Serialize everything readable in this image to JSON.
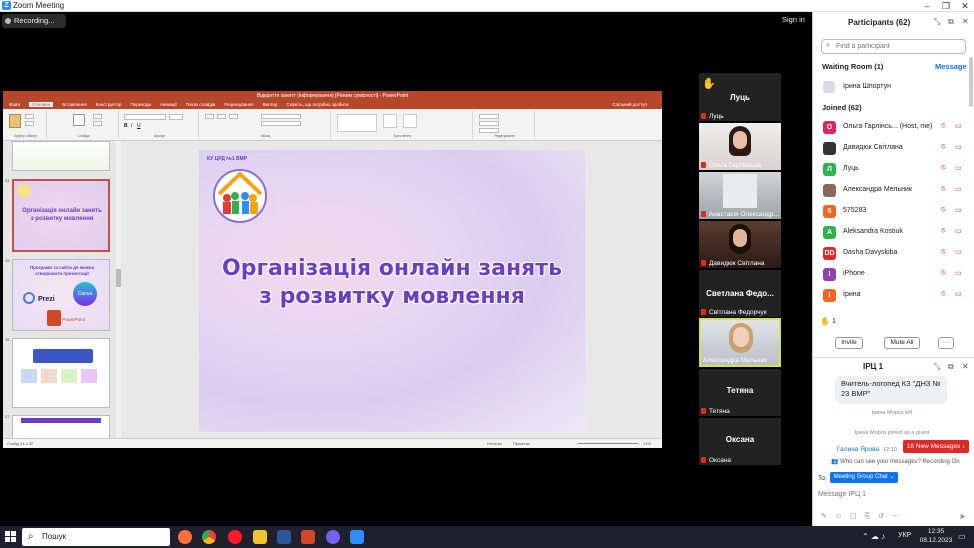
{
  "window": {
    "title": "Zoom Meeting"
  },
  "meeting": {
    "recording_label": "Recording...",
    "signin_label": "Sign in"
  },
  "ppt": {
    "title": "Відкриття занятт (інформування) [Режим сумісності] - PowerPoint",
    "tabs": [
      "Файл",
      "Основне",
      "Вставлення",
      "Конструктор",
      "Переходи",
      "Анімації",
      "Показ слайдів",
      "Рецензування",
      "Вигляд",
      "Скажіть, що потрібно зробити"
    ],
    "share_label": "Спільний доступ",
    "ribbon_groups": [
      "Буфер обміну",
      "Слайди",
      "Шрифт",
      "Абзац",
      "Креслення",
      "Редагування"
    ],
    "slide": {
      "line1": "Організація онлайн занять",
      "line2": "з розвитку мовлення",
      "logo_text": "КУ ЦРД №1 ВМР"
    },
    "thumbs": [
      {
        "num": "23",
        "text": ""
      },
      {
        "num": "24",
        "text": "Організація онлайн занять з розвитку мовлення"
      },
      {
        "num": "25",
        "text": "Програми та сайти де можна створювати презентації"
      },
      {
        "num": "26",
        "text": ""
      },
      {
        "num": "27",
        "text": ""
      }
    ],
    "thumb_brands": {
      "prezi": "Prezi",
      "canva": "Canva",
      "powerpoint": "PowerPoint"
    },
    "status_left": "Слайд 24 з 32",
    "status_notes": "Нотатки",
    "status_comments": "Примітки",
    "zoom_level": "74%"
  },
  "tiles": [
    {
      "name": "Луць",
      "big": "",
      "type": "hand"
    },
    {
      "name": "Ольга Гарлінська",
      "big": "",
      "type": "photo"
    },
    {
      "name": "Анастасія Олександр...",
      "big": "",
      "type": "photo2"
    },
    {
      "name": "Давидюк Світлана",
      "big": "",
      "type": "photo3"
    },
    {
      "name": "Світлана Федорчук",
      "big": "Светлана Федо...",
      "type": "name"
    },
    {
      "name": "Александра Мельник",
      "big": "",
      "type": "active"
    },
    {
      "name": "Тетяна",
      "big": "Тетяна",
      "type": "name"
    },
    {
      "name": "Оксана",
      "big": "Оксана",
      "type": "name"
    }
  ],
  "participants": {
    "header": "Participants (62)",
    "search_placeholder": "Find a participant",
    "waiting_label": "Waiting Room (1)",
    "message_label": "Message",
    "waiting_user": "Ірина Шпортун",
    "joined_label": "Joined (62)",
    "list": [
      {
        "initial": "О",
        "name": "Ольга Гарлінсь... (Host, me)",
        "color": "#e0245e"
      },
      {
        "initial": "",
        "name": "Давидюк Світлана",
        "color": "#333"
      },
      {
        "initial": "Л",
        "name": "Луць",
        "color": "#2fb24c"
      },
      {
        "initial": "",
        "name": "Александра Мельник",
        "color": "#8a6a5a"
      },
      {
        "initial": "5",
        "name": "575283",
        "color": "#f26522"
      },
      {
        "initial": "A",
        "name": "Aleksandra Kostiuk",
        "color": "#2fb24c"
      },
      {
        "initial": "DD",
        "name": "Dasha Davyskiba",
        "color": "#e02828"
      },
      {
        "initial": "I",
        "name": "iPhone",
        "color": "#8e44ad"
      },
      {
        "initial": "I",
        "name": "Ірина",
        "color": "#f26522"
      }
    ],
    "hand_count": "1",
    "invite_label": "Invite",
    "mute_all_label": "Mute All"
  },
  "chat": {
    "header": "ІРЦ 1",
    "bubble": "Вчитель-логопед КЗ \"ДНЗ № 23 ВМР\"",
    "left_msg": "Ірина Мороз left",
    "joined_msg": "Ірина Мороз joined as a guest",
    "last_sender": "Галина Ярова",
    "last_time": "12:10",
    "new_messages": "16 New Messages",
    "who_can_see": "Who can see your messages? Recording On",
    "to_label": "To:",
    "to_target": "Meeting Group Chat",
    "input_placeholder": "Message ІРЦ 1"
  },
  "taskbar": {
    "search_label": "Пошук",
    "lang": "УКР",
    "time": "12:35",
    "date": "08.12.2023"
  }
}
